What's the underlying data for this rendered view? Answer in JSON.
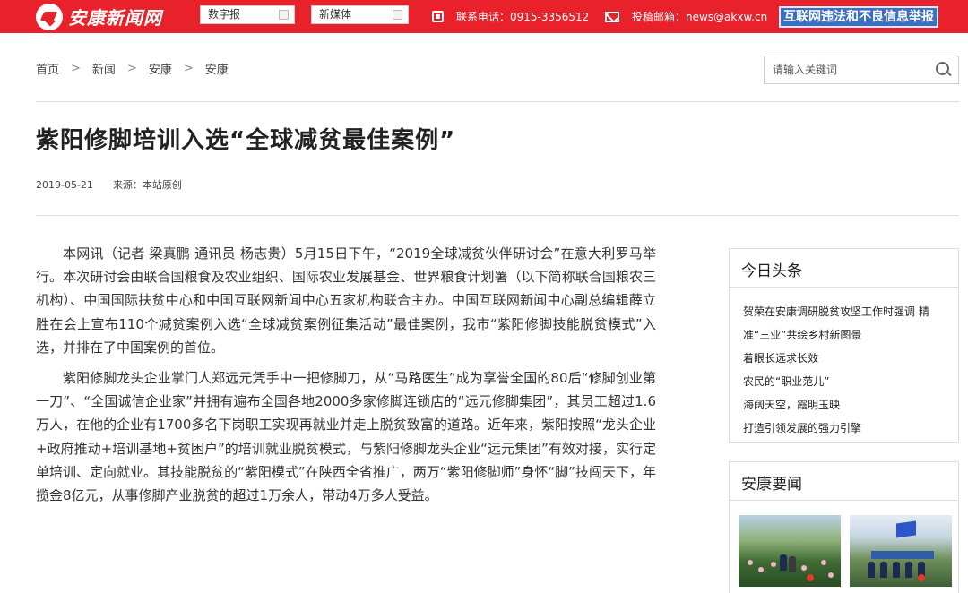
{
  "header": {
    "logo_text": "安康新闻网",
    "select_digital": "数字报",
    "select_newmedia": "新媒体",
    "phone": "联系电话：0915-3356512",
    "email": "投稿邮箱：news@akxw.cn",
    "report_button": "互联网违法和不良信息举报"
  },
  "breadcrumb": [
    "首页",
    "新闻",
    "安康",
    "安康"
  ],
  "breadcrumb_separator": ">",
  "search": {
    "placeholder": "请输入关键词"
  },
  "article": {
    "title": "紫阳修脚培训入选“全球减贫最佳案例”",
    "date": "2019-05-21",
    "source": "来源：本站原创",
    "paragraphs": [
      "本网讯（记者 梁真鹏 通讯员 杨志贵）5月15日下午，“2019全球减贫伙伴研讨会”在意大利罗马举行。本次研讨会由联合国粮食及农业组织、国际农业发展基金、世界粮食计划署（以下简称联合国粮农三机构）、中国国际扶贫中心和中国互联网新闻中心五家机构联合主办。中国互联网新闻中心副总编辑薛立胜在会上宣布110个减贫案例入选“全球减贫案例征集活动”最佳案例，我市“紫阳修脚技能脱贫模式”入选，并排在了中国案例的首位。",
      "紫阳修脚龙头企业掌门人郑远元凭手中一把修脚刀，从“马路医生”成为享誉全国的80后“修脚创业第一刀”、“全国诚信企业家”并拥有遍布全国各地2000多家修脚连锁店的“远元修脚集团”，其员工超过1.6万人，在他的企业有1700多名下岗职工实现再就业并走上脱贫致富的道路。近年来，紫阳按照“龙头企业+政府推动+培训基地+贫困户”的培训就业脱贫模式，与紫阳修脚龙头企业“远元集团”有效对接，实行定单培训、定向就业。其技能脱贫的“紫阳模式”在陕西全省推广，两万“紫阳修脚师”身怀“脚”技闯天下，年揽金8亿元，从事修脚产业脱贫的超过1万余人，带动4万多人受益。"
    ]
  },
  "sidebar": {
    "headlines_title": "今日头条",
    "headlines": [
      "贺荣在安康调研脱贫攻坚工作时强调 精准“三业”共绘乡村新图景",
      "着眼长远求长效",
      "农民的“职业范儿”",
      "海阔天空，霞明玉映",
      "打造引领发展的强力引擎"
    ],
    "ankang_title": "安康要闻"
  },
  "colors": {
    "header_red": "#e8212a",
    "report_blue": "#3a6fc4"
  }
}
